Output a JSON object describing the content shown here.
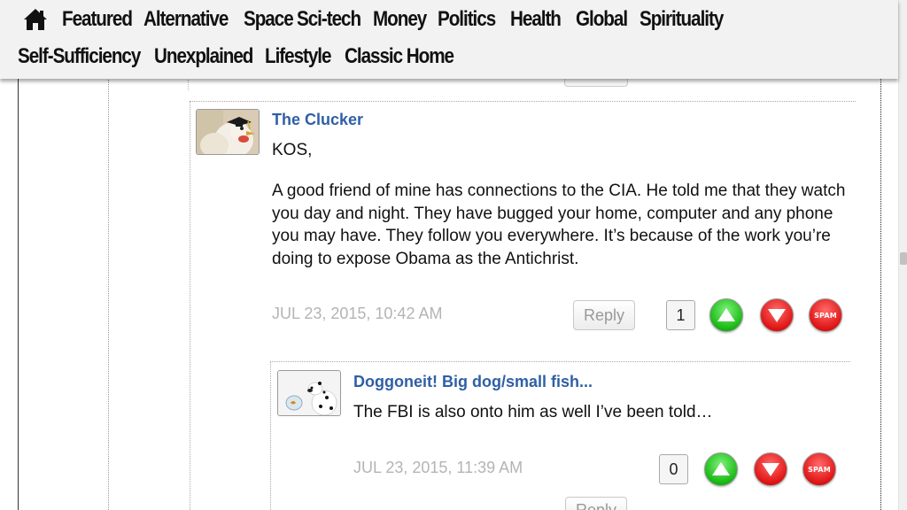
{
  "nav": {
    "home_icon": "home-icon",
    "row1": [
      "Featured",
      "Alternative",
      "Space",
      "Sci-tech",
      "Money",
      "Politics",
      "Health",
      "Global",
      "Spirituality"
    ],
    "row2": [
      "Self-Sufficiency",
      "Unexplained",
      "Lifestyle",
      "Classic Home"
    ]
  },
  "comments": [
    {
      "author": "The Clucker",
      "greeting": "KOS,",
      "paragraph": "A good friend of mine has connections to the CIA. He told me that they watch you day and night. They have bugged your home, computer and any phone you may have. They follow you everywhere. It’s because of the work you’re doing to expose Obama as the Antichrist.",
      "timestamp": "JUL 23, 2015, 10:42 AM",
      "reply_label": "Reply",
      "votes": "1",
      "spam_label": "SPAM"
    },
    {
      "author": "Doggoneit! Big dog/small fish...",
      "paragraph": "The FBI is also onto him as well I’ve been told…",
      "timestamp": "JUL 23, 2015, 11:39 AM",
      "reply_label": "Reply",
      "votes": "0",
      "spam_label": "SPAM"
    }
  ],
  "colors": {
    "author_link": "#2f5fa5",
    "timestamp": "#b4b4b4",
    "upvote": "#19b814",
    "downvote": "#e01414"
  }
}
